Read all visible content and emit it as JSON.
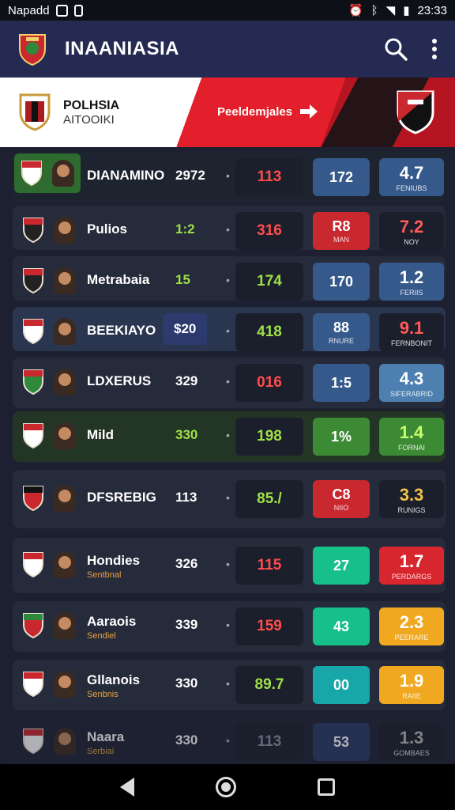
{
  "status_bar": {
    "left_text": "Napadd",
    "time": "23:33"
  },
  "app_bar": {
    "title": "INAANIASIA"
  },
  "banner": {
    "team_name": "POLHSIA",
    "team_sub": "AITOOIKI",
    "predictions_label": "Peeldemjales"
  },
  "rows": [
    {
      "name": "DIANAMINO",
      "sub": "",
      "score": "2972",
      "mid": "113",
      "mid_color": "#ff4d4d",
      "b1_value": "172",
      "b1_sub": "",
      "b1_bg": "#35598a",
      "b2_value": "4.7",
      "b2_sub": "FENIUBS",
      "b2_bg": "#35598a",
      "row_bg": "#1e2330",
      "logo_bg": "#2e6b2f"
    },
    {
      "name": "Pulios",
      "sub": "",
      "score": "1:2",
      "score_color": "#9fe04a",
      "mid": "316",
      "mid_color": "#ff4d4d",
      "b1_value": "R8",
      "b1_sub": "MAN",
      "b1_bg": "#c9282f",
      "b2_value": "7.2",
      "b2_sub": "NOY",
      "b2_bg": "#1b1f2b",
      "b2_color": "#ff5a5a",
      "row_bg": "#262b3b"
    },
    {
      "name": "Metrabaia",
      "sub": "",
      "score": "15",
      "score_color": "#9fe04a",
      "mid": "174",
      "mid_color": "#9fe04a",
      "b1_value": "170",
      "b1_sub": "",
      "b1_bg": "#35598a",
      "b2_value": "1.2",
      "b2_sub": "FERIIS",
      "b2_bg": "#35598a",
      "row_bg": "#262b3b"
    },
    {
      "name": "BEEKIAYO",
      "sub": "",
      "score": "$20",
      "mid": "418",
      "mid_color": "#9fe04a",
      "b1_value": "88",
      "b1_sub": "RNURE",
      "b1_bg": "#35598a",
      "b2_value": "9.1",
      "b2_sub": "FERNBONIT",
      "b2_bg": "#1b1f2b",
      "b2_color": "#ff5a5a",
      "row_bg": "#2a3550",
      "score_box": true
    },
    {
      "name": "LDXERUS",
      "sub": "",
      "score": "329",
      "mid": "016",
      "mid_color": "#ff4d4d",
      "b1_value": "1:5",
      "b1_sub": "",
      "b1_bg": "#35598a",
      "b2_value": "4.3",
      "b2_sub": "SIFERABRID",
      "b2_bg": "#4d7fb0",
      "row_bg": "#262b3b"
    },
    {
      "name": "Mild",
      "sub": "",
      "score": "330",
      "score_color": "#9fe04a",
      "mid": "198",
      "mid_color": "#9fe04a",
      "b1_value": "1%",
      "b1_sub": "",
      "b1_bg": "#3d8a35",
      "b2_value": "1.4",
      "b2_sub": "FORNAI",
      "b2_bg": "#3d8a35",
      "b2_color": "#c8ff6a",
      "row_bg": "#233626"
    },
    {
      "name": "DFSREBIG",
      "sub": "",
      "score": "113",
      "mid": "85./",
      "mid_color": "#9fe04a",
      "b1_value": "C8",
      "b1_sub": "NIIO",
      "b1_bg": "#c9282f",
      "b2_value": "3.3",
      "b2_sub": "RUNIGS",
      "b2_bg": "#1b1f2b",
      "b2_color": "#f2c14a",
      "row_bg": "#262b3b"
    },
    {
      "name": "Hondies",
      "sub": "Sentbnal",
      "score": "326",
      "mid": "115",
      "mid_color": "#ff4d4d",
      "b1_value": "27",
      "b1_sub": "",
      "b1_bg": "#17c08a",
      "b2_value": "1.7",
      "b2_sub": "PERDARGS",
      "b2_bg": "#d8262e",
      "row_bg": "#262b3b"
    },
    {
      "name": "Aaraois",
      "sub": "Sendiel",
      "score": "339",
      "mid": "159",
      "mid_color": "#ff4d4d",
      "b1_value": "43",
      "b1_sub": "",
      "b1_bg": "#17c08a",
      "b2_value": "2.3",
      "b2_sub": "PEERARE",
      "b2_bg": "#f0a821",
      "row_bg": "#262b3b"
    },
    {
      "name": "Gllanois",
      "sub": "Senbnis",
      "score": "330",
      "mid": "89.7",
      "mid_color": "#9fe04a",
      "b1_value": "00",
      "b1_sub": "",
      "b1_bg": "#17a7a8",
      "b2_value": "1.9",
      "b2_sub": "RAIIE",
      "b2_bg": "#f0a821",
      "row_bg": "#262b3b"
    },
    {
      "name": "Naara",
      "sub": "Serbiai",
      "score": "330",
      "mid": "113",
      "mid_color": "#8a8fa0",
      "b1_value": "53",
      "b1_sub": "",
      "b1_bg": "#2b3b66",
      "b2_value": "1.3",
      "b2_sub": "GOMBAES",
      "b2_bg": "#1b1f2b",
      "b2_color": "#b8b8b8",
      "row_bg": "#1e2232",
      "faded": true
    }
  ]
}
